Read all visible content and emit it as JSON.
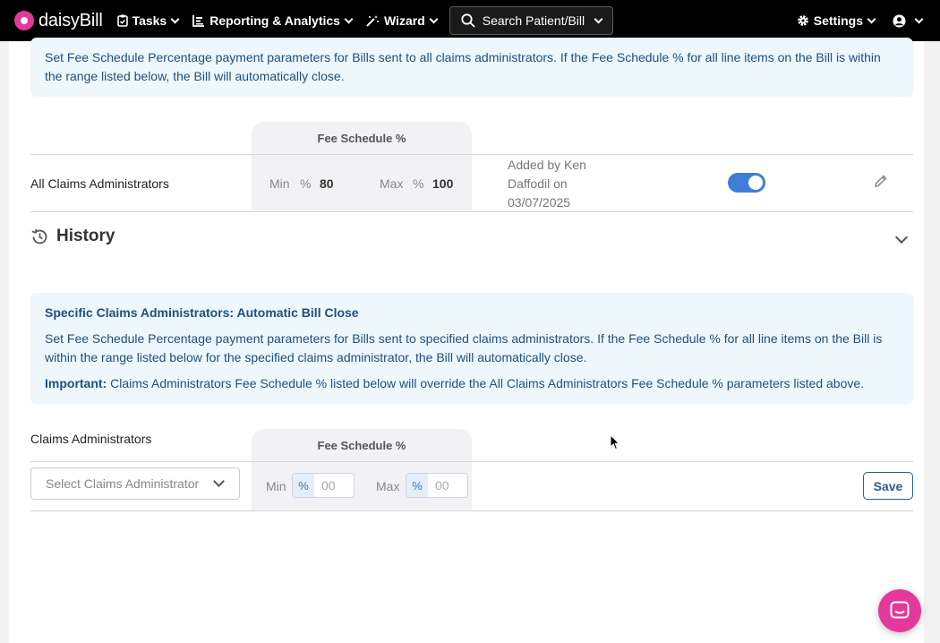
{
  "nav": {
    "logo": "daisyBill",
    "tasks": "Tasks",
    "reporting": "Reporting & Analytics",
    "wizard": "Wizard",
    "search": "Search Patient/Bill",
    "settings": "Settings"
  },
  "all_admins": {
    "info": "Set Fee Schedule Percentage payment parameters for Bills sent to all claims administrators. If the Fee Schedule % for all line items on the Bill is within the range listed below, the Bill will automatically close.",
    "fee_header": "Fee Schedule %",
    "row": {
      "label": "All Claims Administrators",
      "min_label": "Min",
      "max_label": "Max",
      "pct": "%",
      "min": "80",
      "max": "100",
      "added_by": "Added by Ken Daffodil on 03/07/2025",
      "enabled": true
    }
  },
  "history": {
    "title": "History"
  },
  "specific": {
    "title": "Specific Claims Administrators: Automatic Bill Close",
    "description": "Set Fee Schedule Percentage payment parameters for Bills sent to specified claims administrators. If the Fee Schedule % for all line items on the Bill is within the range listed below for the specified claims administrator, the Bill will automatically close.",
    "important_label": "Important:",
    "important_text": " Claims Administrators Fee Schedule % listed below will override the All Claims Administrators Fee Schedule % parameters listed above.",
    "column_label": "Claims Administrators",
    "fee_header": "Fee Schedule %",
    "select_placeholder": "Select Claims Administrator",
    "min_label": "Min",
    "max_label": "Max",
    "pct": "%",
    "min_placeholder": "00",
    "max_placeholder": "00",
    "save": "Save"
  },
  "colors": {
    "accent": "#e4399b",
    "toggle": "#3f7ed8",
    "info_bg": "#eef7fc",
    "info_text": "#20507f"
  }
}
